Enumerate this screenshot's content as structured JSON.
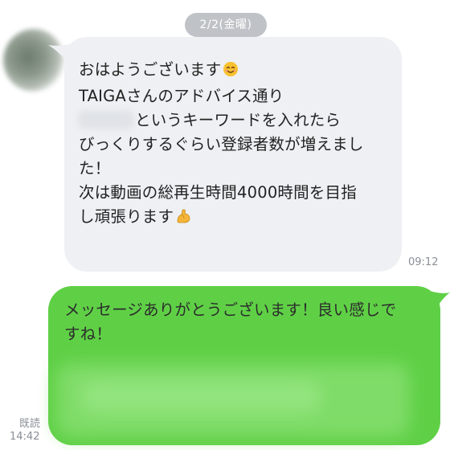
{
  "date_separator": "2/2(金曜)",
  "incoming_message": {
    "lines": [
      "おはようございます",
      "TAIGAさんのアドバイス通り",
      "というキーワードを入れたら",
      "びっくりするぐらい登録者数が増えまし",
      "た！",
      "次は動画の総再生時間4000時間を目指",
      "し頑張ります"
    ],
    "emoji_smile": "smiling-face-emoji",
    "emoji_muscle": "flexed-biceps-emoji",
    "time": "09:12",
    "bubble_color": "#eef0f3"
  },
  "outgoing_message": {
    "lines": [
      "メッセージありがとうございます！良い感じで",
      "すね！"
    ],
    "read_label": "既読",
    "time": "14:42",
    "bubble_color": "#5fd046"
  }
}
